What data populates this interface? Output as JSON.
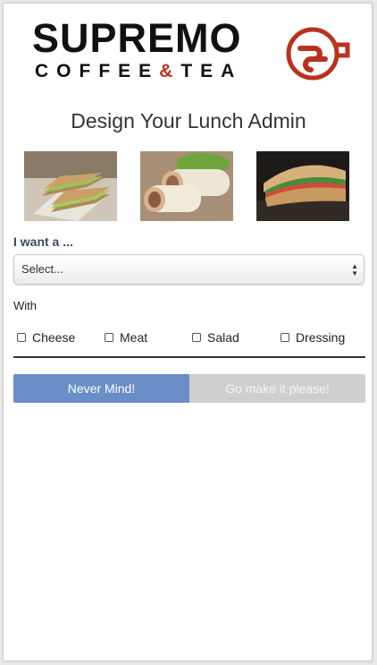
{
  "brand": {
    "name": "SUPREMO",
    "tagline_left": "COFFEE",
    "tagline_amp": "&",
    "tagline_right": "TEA",
    "accent_color": "#b8321f"
  },
  "page": {
    "title": "Design Your Lunch Admin"
  },
  "photos": [
    {
      "name": "sandwich-photo"
    },
    {
      "name": "wrap-photo"
    },
    {
      "name": "panini-photo"
    }
  ],
  "form": {
    "want_label": "I want a ...",
    "select_value": "Select...",
    "with_label": "With",
    "options": [
      "Cheese",
      "Meat",
      "Salad",
      "Dressing"
    ]
  },
  "buttons": {
    "never_mind": "Never Mind!",
    "go_make": "Go make it please!",
    "never_mind_color": "#6a8ec8",
    "go_make_color": "#cfcfcf"
  }
}
